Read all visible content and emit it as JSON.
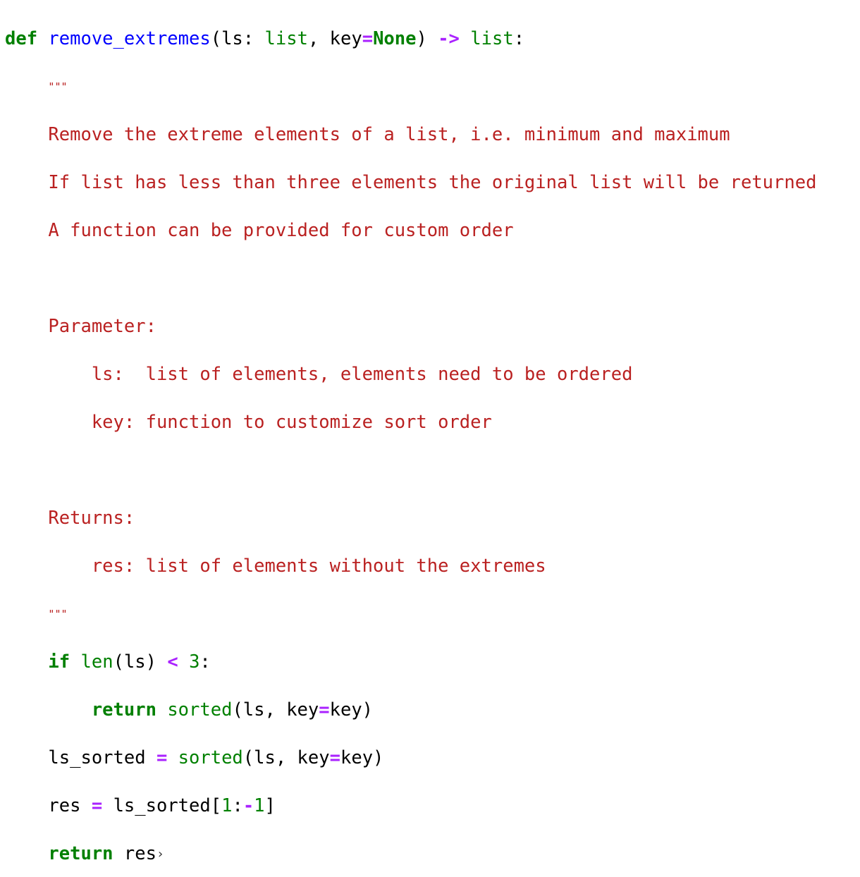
{
  "code": {
    "def_kw": "def",
    "func_name": "remove_extremes",
    "paren_open": "(",
    "param_ls": "ls",
    "colon": ":",
    "type_list": "list",
    "comma_key": ", key",
    "eq": "=",
    "none_kw": "None",
    "paren_close": ")",
    "arrow": "->",
    "return_type": "list",
    "end_colon": ":",
    "docstring_quote": "\"\"\"",
    "doc_lines": [
      "Remove the extreme elements of a list, i.e. minimum and maximum",
      "If list has less than three elements the original list will be returned",
      "A function can be provided for custom order",
      "",
      "Parameter:",
      "    ls:  list of elements, elements need to be ordered",
      "    key: function to customize sort order",
      "",
      "Returns:",
      "    res: list of elements without the extremes"
    ],
    "if_kw": "if",
    "len_fn": "len",
    "len_arg": "(ls)",
    "lt_op": "<",
    "three": "3",
    "return_kw": "return",
    "sorted_fn": "sorted",
    "sorted_args_a": "(ls, key",
    "sorted_args_b": "key)",
    "ls_sorted_var": "ls_sorted",
    "assign": "=",
    "res_var": "res",
    "ls_sorted_index": "ls_sorted[",
    "one": "1",
    "slice_colon": ":",
    "minus": "-",
    "one_b": "1",
    "close_bracket": "]",
    "return_res": "res",
    "caret": "›"
  }
}
